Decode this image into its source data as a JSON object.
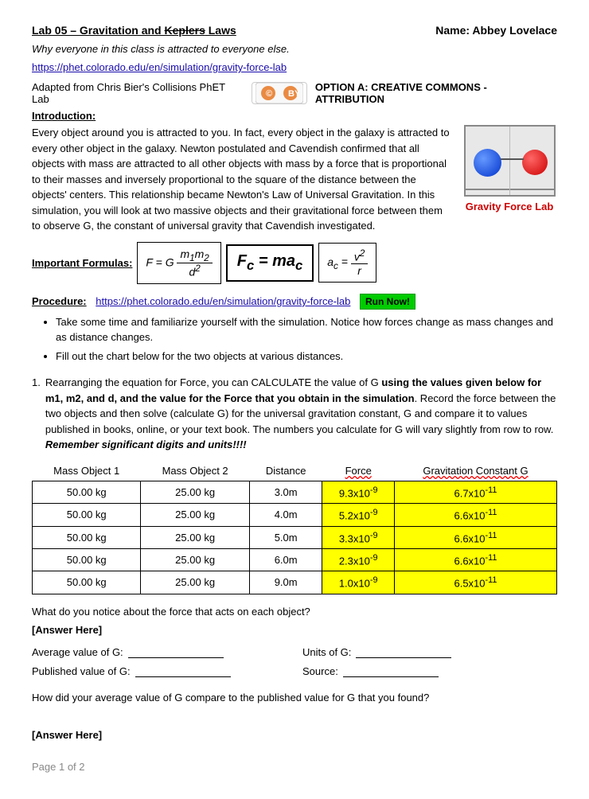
{
  "header": {
    "title_prefix": "Lab 05 – Gravitation and ",
    "title_strikethrough": "Keplers",
    "title_suffix": " Laws",
    "name_label": "Name: Abbey Lovelace"
  },
  "subtitle": "Why everyone in this class is attracted to everyone else.",
  "link": "https://phet.colorado.edu/en/simulation/gravity-force-lab",
  "cc_text": "Adapted from Chris Bier's Collisions PhET Lab",
  "option_text": "OPTION A: CREATIVE COMMONS - ATTRIBUTION",
  "intro": {
    "header": "Introduction:",
    "body": "Every object around you is attracted to you.  In fact, every object in the galaxy is attracted to every other object in the galaxy.  Newton postulated and Cavendish confirmed that all objects with mass are attracted to all other objects with mass by a force that is proportional to their masses and inversely proportional to the square of the distance between the objects' centers.  This relationship became Newton's Law of Universal Gravitation.  In this simulation, you will look at two massive objects and their gravitational force between them to observe G, the constant of universal gravity that Cavendish investigated."
  },
  "gravity_label": "Gravity Force Lab",
  "formulas": {
    "label": "Important Formulas:",
    "f1": "F = G m₁m₂ / d²",
    "f2": "Fc = mac",
    "f3": "ac = v² / r"
  },
  "procedure": {
    "label": "Procedure:",
    "link": "https://phet.colorado.edu/en/simulation/gravity-force-lab",
    "run_now": "Run Now!",
    "bullets": [
      "Take some time and familiarize yourself with the simulation.  Notice how forces change as mass changes and as distance changes.",
      "Fill out the chart below for the two objects at various distances."
    ]
  },
  "question1": {
    "number": "1.",
    "text_before": "Rearranging the equation for Force, you can CALCULATE the value of G ",
    "bold_part": "using the values given below for m1, m2, and d, and the value for the Force that you obtain in the simulation",
    "text_after": ".  Record the force between the two objects and then solve (calculate G) for the universal gravitation constant, G and compare it to values published in books, online, or your text book.  The numbers you calculate for G will vary slightly from row to row.",
    "bold_end": "Remember significant digits and units!!!!"
  },
  "table": {
    "headers": [
      "Mass Object 1",
      "Mass Object 2",
      "Distance",
      "Force",
      "Gravitation Constant G"
    ],
    "rows": [
      {
        "m1": "50.00 kg",
        "m2": "25.00 kg",
        "dist": "3.0m",
        "force": "9.3x10⁻⁹",
        "grav": "6.7x10⁻¹¹"
      },
      {
        "m1": "50.00 kg",
        "m2": "25.00 kg",
        "dist": "4.0m",
        "force": "5.2x10⁻⁹",
        "grav": "6.6x10⁻¹¹"
      },
      {
        "m1": "50.00 kg",
        "m2": "25.00 kg",
        "dist": "5.0m",
        "force": "3.3x10⁻⁹",
        "grav": "6.6x10⁻¹¹"
      },
      {
        "m1": "50.00 kg",
        "m2": "25.00 kg",
        "dist": "6.0m",
        "force": "2.3x10⁻⁹",
        "grav": "6.6x10⁻¹¹"
      },
      {
        "m1": "50.00 kg",
        "m2": "25.00 kg",
        "dist": "9.0m",
        "force": "1.0x10⁻⁹",
        "grav": "6.5x10⁻¹¹"
      }
    ]
  },
  "notice_q": "What do you notice about the force that acts on each object?",
  "answer_here": "[Answer Here]",
  "avg_g_label": "Average value of G:",
  "units_g_label": "Units of G:",
  "published_g_label": "Published value of G:",
  "source_label": "Source:",
  "compare_q": "How did your average value of G compare to the published value for G that you found?",
  "answer_here2": "[Answer Here]",
  "page_footer": "Page 1 of 2"
}
